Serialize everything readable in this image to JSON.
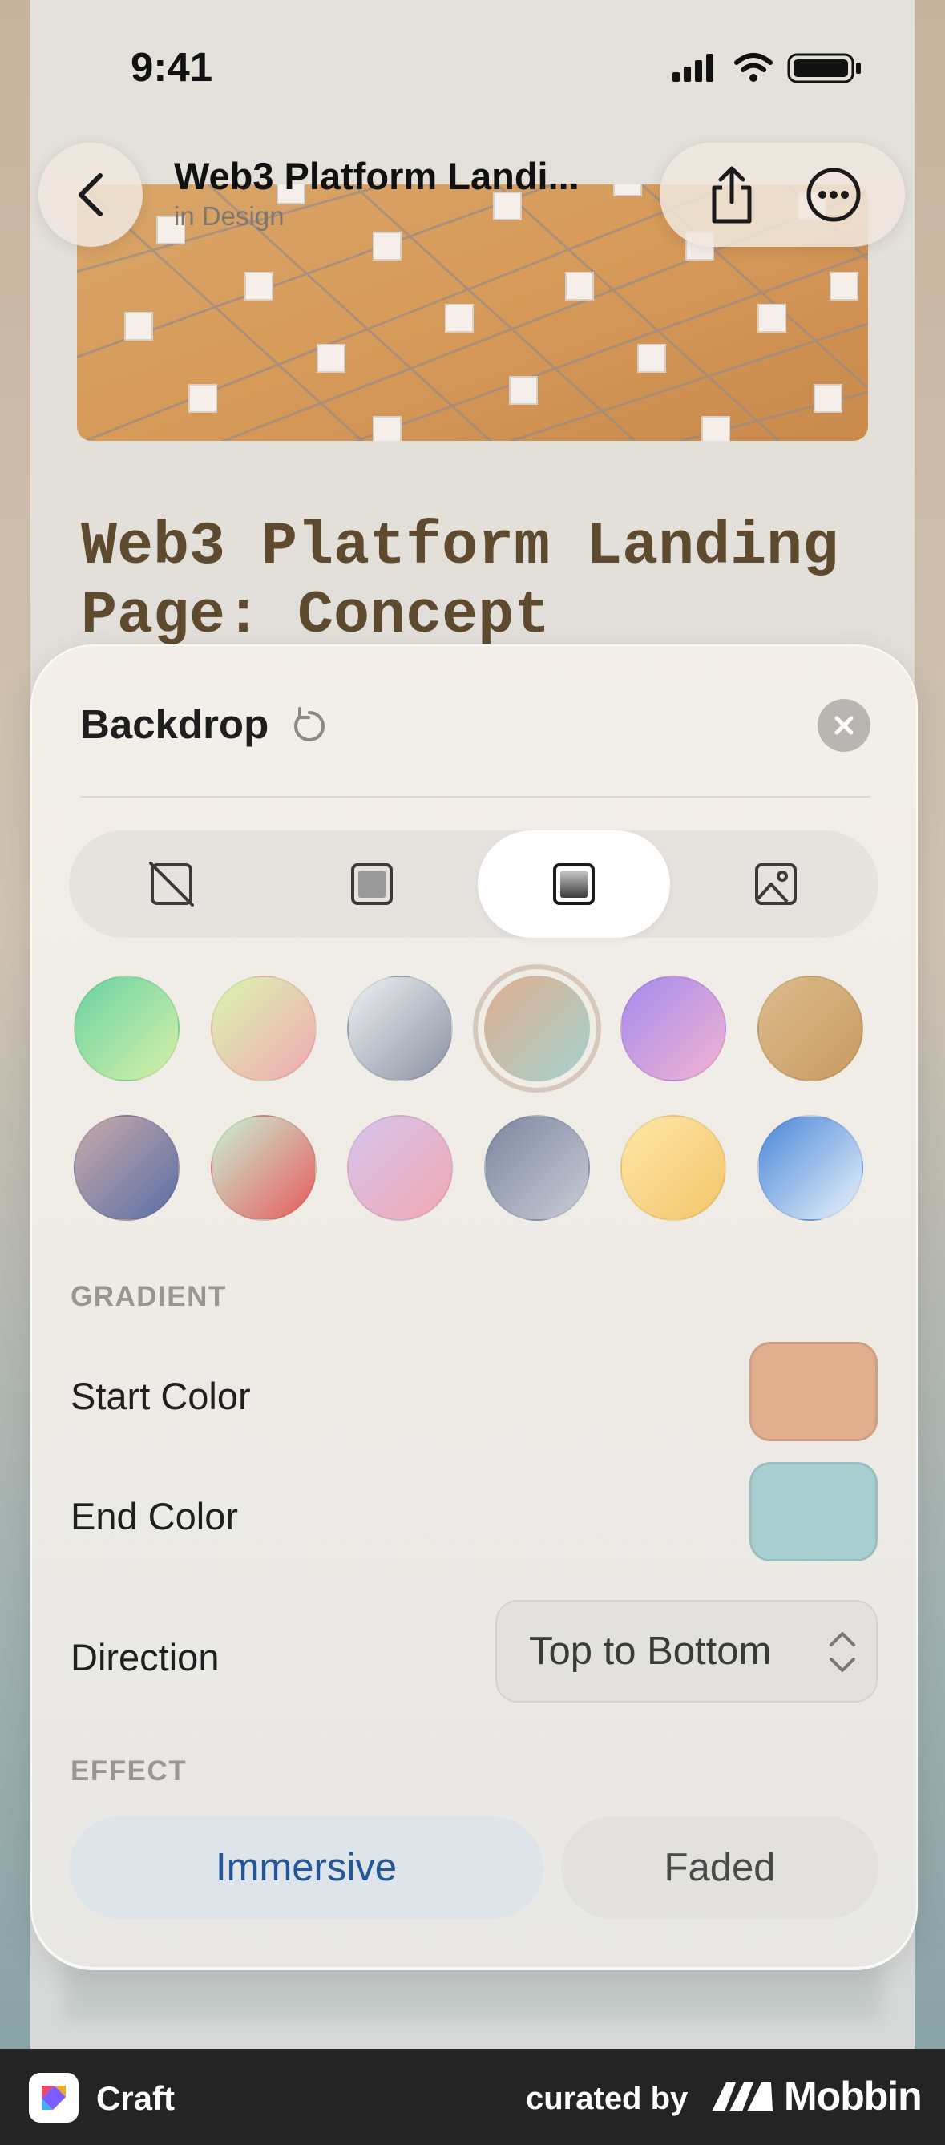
{
  "status_bar": {
    "time": "9:41"
  },
  "nav": {
    "title": "Web3 Platform Landi...",
    "subtitle": "in Design"
  },
  "document": {
    "title_line1": "Web3 Platform Landing",
    "title_line2": "Page: Concept"
  },
  "sheet": {
    "title": "Backdrop",
    "segments": [
      {
        "icon": "no-backdrop-icon",
        "active": false
      },
      {
        "icon": "solid-color-icon",
        "active": false
      },
      {
        "icon": "gradient-icon",
        "active": true
      },
      {
        "icon": "image-icon",
        "active": false
      }
    ],
    "swatches": [
      {
        "from": "#69d3a3",
        "to": "#d8f0a8",
        "selected": false
      },
      {
        "from": "#d9f6b0",
        "to": "#f2a8b2",
        "selected": false
      },
      {
        "from": "#eef0f3",
        "to": "#8a93a2",
        "selected": false
      },
      {
        "from": "#e1ae8e",
        "to": "#a3d1cf",
        "selected": true
      },
      {
        "from": "#a58bf0",
        "to": "#f3b3d0",
        "selected": false
      },
      {
        "from": "#dcbc8c",
        "to": "#c99a62",
        "selected": false
      },
      {
        "from": "#c8aaa8",
        "to": "#5a6ea8",
        "selected": false
      },
      {
        "from": "#c7f3d8",
        "to": "#e85a5a",
        "selected": false
      },
      {
        "from": "#d6c4ee",
        "to": "#f1a9b2",
        "selected": false
      },
      {
        "from": "#7c86a0",
        "to": "#c8ccd6",
        "selected": false
      },
      {
        "from": "#fde7a8",
        "to": "#f4c56a",
        "selected": false
      },
      {
        "from": "#4a86d8",
        "to": "#eaf2fb",
        "selected": false
      }
    ],
    "gradient_section": "GRADIENT",
    "start_color_label": "Start Color",
    "start_color": "#e1ae8e",
    "end_color_label": "End Color",
    "end_color": "#a8cfd0",
    "direction_label": "Direction",
    "direction_value": "Top to Bottom",
    "effect_section": "EFFECT",
    "effect_options": [
      {
        "label": "Immersive",
        "active": true
      },
      {
        "label": "Faded",
        "active": false
      }
    ]
  },
  "brand_bar": {
    "app_name": "Craft",
    "curated_by": "curated by",
    "brand": "Mobbin"
  }
}
